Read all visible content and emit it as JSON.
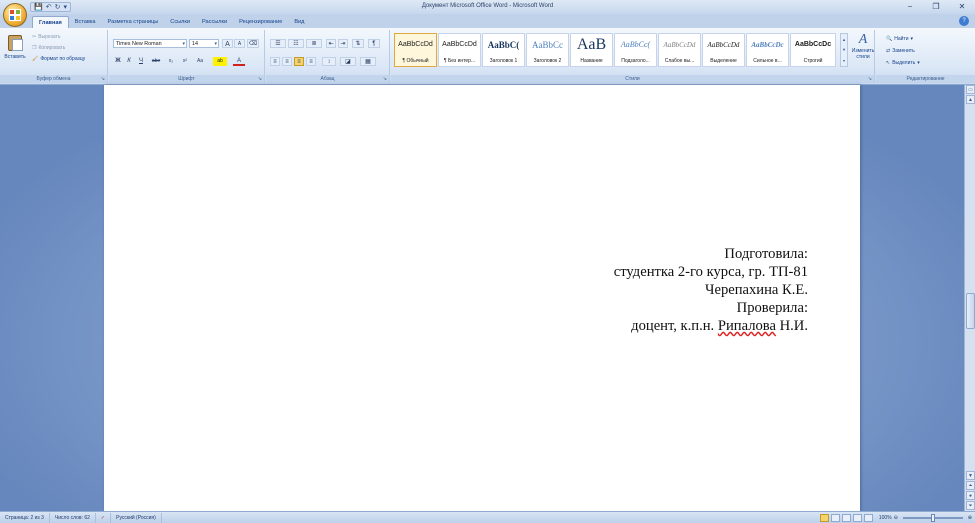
{
  "window": {
    "title": "Документ Microsoft Office Word - Microsoft Word",
    "controls": {
      "minimize": "−",
      "restore": "❐",
      "close": "✕"
    }
  },
  "qat": {
    "save": "💾",
    "undo": "↶",
    "redo": "↻",
    "more": "▾"
  },
  "tabs": [
    "Главная",
    "Вставка",
    "Разметка страницы",
    "Ссылки",
    "Рассылки",
    "Рецензирование",
    "Вид"
  ],
  "active_tab": "Главная",
  "ribbon": {
    "clipboard": {
      "label": "Буфер обмена",
      "paste": "Вставить",
      "cut": "Вырезать",
      "copy": "Копировать",
      "format_painter": "Формат по образцу"
    },
    "font": {
      "label": "Шрифт",
      "font_name": "Times New Roman",
      "font_size": "14",
      "bold": "Ж",
      "italic": "К",
      "underline": "Ч",
      "strike": "abe",
      "subscript": "x₂",
      "superscript": "x²",
      "change_case": "Aa",
      "grow": "A",
      "shrink": "A",
      "clear": "⌫",
      "highlight": "ab",
      "font_color": "A"
    },
    "paragraph": {
      "label": "Абзац",
      "pilcrow": "¶"
    },
    "styles": {
      "label": "Стили",
      "items": [
        {
          "sample": "AaBbCcDd",
          "name": "¶ Обычный"
        },
        {
          "sample": "AaBbCcDd",
          "name": "¶ Без интер..."
        },
        {
          "sample": "AaBbC(",
          "name": "Заголовок 1"
        },
        {
          "sample": "AaBbCc",
          "name": "Заголовок 2"
        },
        {
          "sample": "AaB",
          "name": "Название"
        },
        {
          "sample": "AaBbCc(",
          "name": "Подзаголо..."
        },
        {
          "sample": "AaBbCcDd",
          "name": "Слабое вы..."
        },
        {
          "sample": "AaBbCcDd",
          "name": "Выделение"
        },
        {
          "sample": "AaBbCcDc",
          "name": "Сильное в..."
        },
        {
          "sample": "AaBbCcDc",
          "name": "Строгий"
        }
      ],
      "change_styles": "Изменить стили"
    },
    "editing": {
      "label": "Редактирование",
      "find": "Найти",
      "replace": "Заменить",
      "select": "Выделить"
    }
  },
  "document": {
    "lines": [
      "Подготовила:",
      "студентка 2-го курса, гр. ТП-81",
      "Черепахина К.Е.",
      "Проверила:"
    ],
    "last_line_prefix": "доцент, к.п.н. ",
    "last_line_misspelled": "Рипалова",
    "last_line_suffix": " Н.И."
  },
  "status": {
    "page": "Страница: 2 из 3",
    "words": "Число слов: 62",
    "language": "Русский (Россия)",
    "zoom": "100%"
  },
  "colors": {
    "accent": "#15428b",
    "ribbon": "#dbe7f6",
    "workspace": "#6d8fc2",
    "spell_error": "#e02020"
  }
}
